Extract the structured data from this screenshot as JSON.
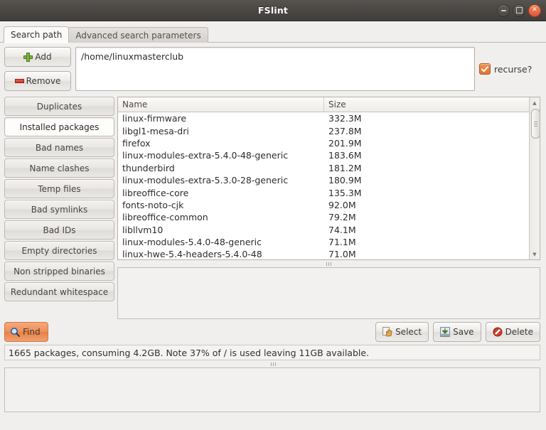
{
  "window": {
    "title": "FSlint",
    "controls": [
      {
        "name": "minimize",
        "glyph": "−"
      },
      {
        "name": "maximize",
        "glyph": "□"
      },
      {
        "name": "close",
        "glyph": "×"
      }
    ]
  },
  "tabs": [
    {
      "label": "Search path",
      "active": true
    },
    {
      "label": "Advanced search parameters",
      "active": false
    }
  ],
  "search": {
    "add_label": "Add",
    "remove_label": "Remove",
    "path_value": "/home/linuxmasterclub",
    "path_placeholder": "",
    "recurse_label": "recurse?",
    "recurse_checked": true
  },
  "sidebar": {
    "items": [
      {
        "label": "Duplicates",
        "active": false
      },
      {
        "label": "Installed packages",
        "active": true
      },
      {
        "label": "Bad names",
        "active": false
      },
      {
        "label": "Name clashes",
        "active": false
      },
      {
        "label": "Temp files",
        "active": false
      },
      {
        "label": "Bad symlinks",
        "active": false
      },
      {
        "label": "Bad IDs",
        "active": false
      },
      {
        "label": "Empty directories",
        "active": false
      },
      {
        "label": "Non stripped binaries",
        "active": false
      },
      {
        "label": "Redundant whitespace",
        "active": false
      }
    ]
  },
  "list": {
    "columns": [
      "Name",
      "Size"
    ],
    "rows": [
      {
        "name": "linux-firmware",
        "size": "332.3M"
      },
      {
        "name": "libgl1-mesa-dri",
        "size": "237.8M"
      },
      {
        "name": "firefox",
        "size": "201.9M"
      },
      {
        "name": "linux-modules-extra-5.4.0-48-generic",
        "size": "183.6M"
      },
      {
        "name": "thunderbird",
        "size": "181.2M"
      },
      {
        "name": "linux-modules-extra-5.3.0-28-generic",
        "size": "180.9M"
      },
      {
        "name": "libreoffice-core",
        "size": "135.3M"
      },
      {
        "name": "fonts-noto-cjk",
        "size": "92.0M"
      },
      {
        "name": "libreoffice-common",
        "size": "79.2M"
      },
      {
        "name": "libllvm10",
        "size": "74.1M"
      },
      {
        "name": "linux-modules-5.4.0-48-generic",
        "size": "71.1M"
      },
      {
        "name": "linux-hwe-5.4-headers-5.4.0-48",
        "size": "71.0M"
      }
    ]
  },
  "actions": {
    "find_label": "Find",
    "select_label": "Select",
    "save_label": "Save",
    "delete_label": "Delete"
  },
  "status": {
    "text": "1665 packages, consuming 4.2GB. Note 37% of / is used leaving 11GB available."
  },
  "colors": {
    "accent_orange": "#ef8f56",
    "checkbox_orange": "#e2743a",
    "titlebar": "#4a4744",
    "close_button": "#e2553b",
    "add_green": "#7cb342",
    "remove_red": "#c3372a"
  }
}
